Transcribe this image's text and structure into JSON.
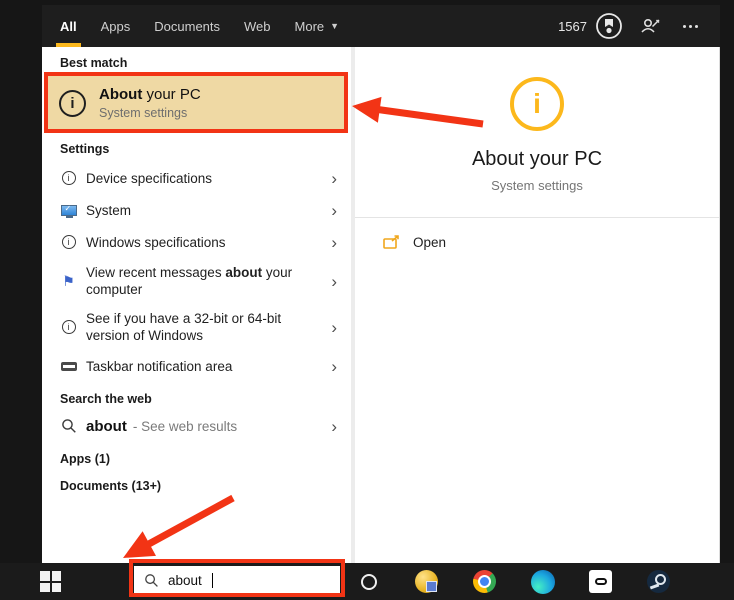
{
  "colors": {
    "accent": "#fcb81c",
    "annotation": "#f23415",
    "highlight": "#efd9a4",
    "panel": "#ffffff",
    "dark": "#1e1e1e",
    "desktop": "#161616",
    "taskbar": "#1b1b1b"
  },
  "header": {
    "tabs": [
      {
        "label": "All"
      },
      {
        "label": "Apps"
      },
      {
        "label": "Documents"
      },
      {
        "label": "Web"
      },
      {
        "label": "More"
      }
    ],
    "rewards_count": "1567"
  },
  "left": {
    "best_match_header": "Best match",
    "best_match": {
      "title_bold": "About",
      "title_rest": " your PC",
      "subtitle": "System settings"
    },
    "settings_header": "Settings",
    "settings_items": [
      {
        "icon": "info-icon",
        "label": "Device specifications"
      },
      {
        "icon": "system-monitor-icon",
        "label": "System"
      },
      {
        "icon": "info-icon",
        "label": "Windows specifications"
      },
      {
        "icon": "flag-icon",
        "pre": "View recent messages ",
        "bold": "about",
        "post": " your computer"
      },
      {
        "icon": "info-icon",
        "label": "See if you have a 32-bit or 64-bit version of Windows"
      },
      {
        "icon": "taskbar-icon",
        "label": "Taskbar notification area"
      }
    ],
    "search_web_header": "Search the web",
    "web_result": {
      "query": "about",
      "suffix": "- See web results"
    },
    "apps_header": "Apps (1)",
    "documents_header": "Documents (13+)"
  },
  "right": {
    "title": "About your PC",
    "subtitle": "System settings",
    "open_label": "Open"
  },
  "taskbar": {
    "search_value": "about"
  }
}
